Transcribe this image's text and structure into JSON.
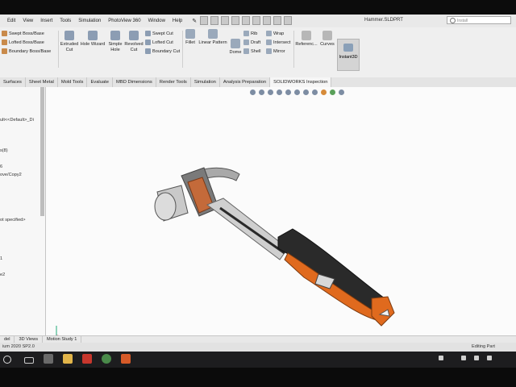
{
  "menubar": {
    "items": [
      "Edit",
      "View",
      "Insert",
      "Tools",
      "Simulation",
      "PhotoView 360",
      "Window",
      "Help"
    ],
    "document_title": "Hammer.SLDPRT",
    "search_placeholder": "Install"
  },
  "ribbon": {
    "boss_group": [
      "Swept Boss/Base",
      "Lofted Boss/Base",
      "Boundary Boss/Base"
    ],
    "extruded_cut": "Extruded Cut",
    "hole_wizard": "Hole Wizard",
    "simple_hole": "Simple Hole",
    "revolved_cut": "Revolved Cut",
    "cut_group": [
      "Swept Cut",
      "Lofted Cut",
      "Boundary Cut"
    ],
    "fillet": "Fillet",
    "linear_pattern": "Linear Pattern",
    "dome": "Dome",
    "rib_group": [
      "Rib",
      "Draft",
      "Shell"
    ],
    "wrap_group": [
      "Wrap",
      "Intersect",
      "Mirror"
    ],
    "reference": "Referenc...",
    "curves": "Curves",
    "instant3d": "Instant3D"
  },
  "command_tabs": [
    "Surfaces",
    "Sheet Metal",
    "Mold Tools",
    "Evaluate",
    "MBD Dimensions",
    "Render Tools",
    "Simulation",
    "Analysis Preparation",
    "SOLIDWORKS Inspection"
  ],
  "feature_tree": {
    "items": [
      "ult<<Default>_Di",
      "s(8)",
      "6",
      "ove/Copy2",
      "ot specified>",
      "1",
      "e2"
    ]
  },
  "bottom_tabs": [
    "del",
    "3D Views",
    "Motion Study 1"
  ],
  "status": {
    "left": "ium 2020 SP2.0",
    "right": "Editing Part"
  },
  "colors": {
    "accent_orange": "#e06a1e",
    "handle_dark": "#2a2a2a",
    "metal": "#bdbdbd",
    "ribbon_bg": "#efefef"
  }
}
